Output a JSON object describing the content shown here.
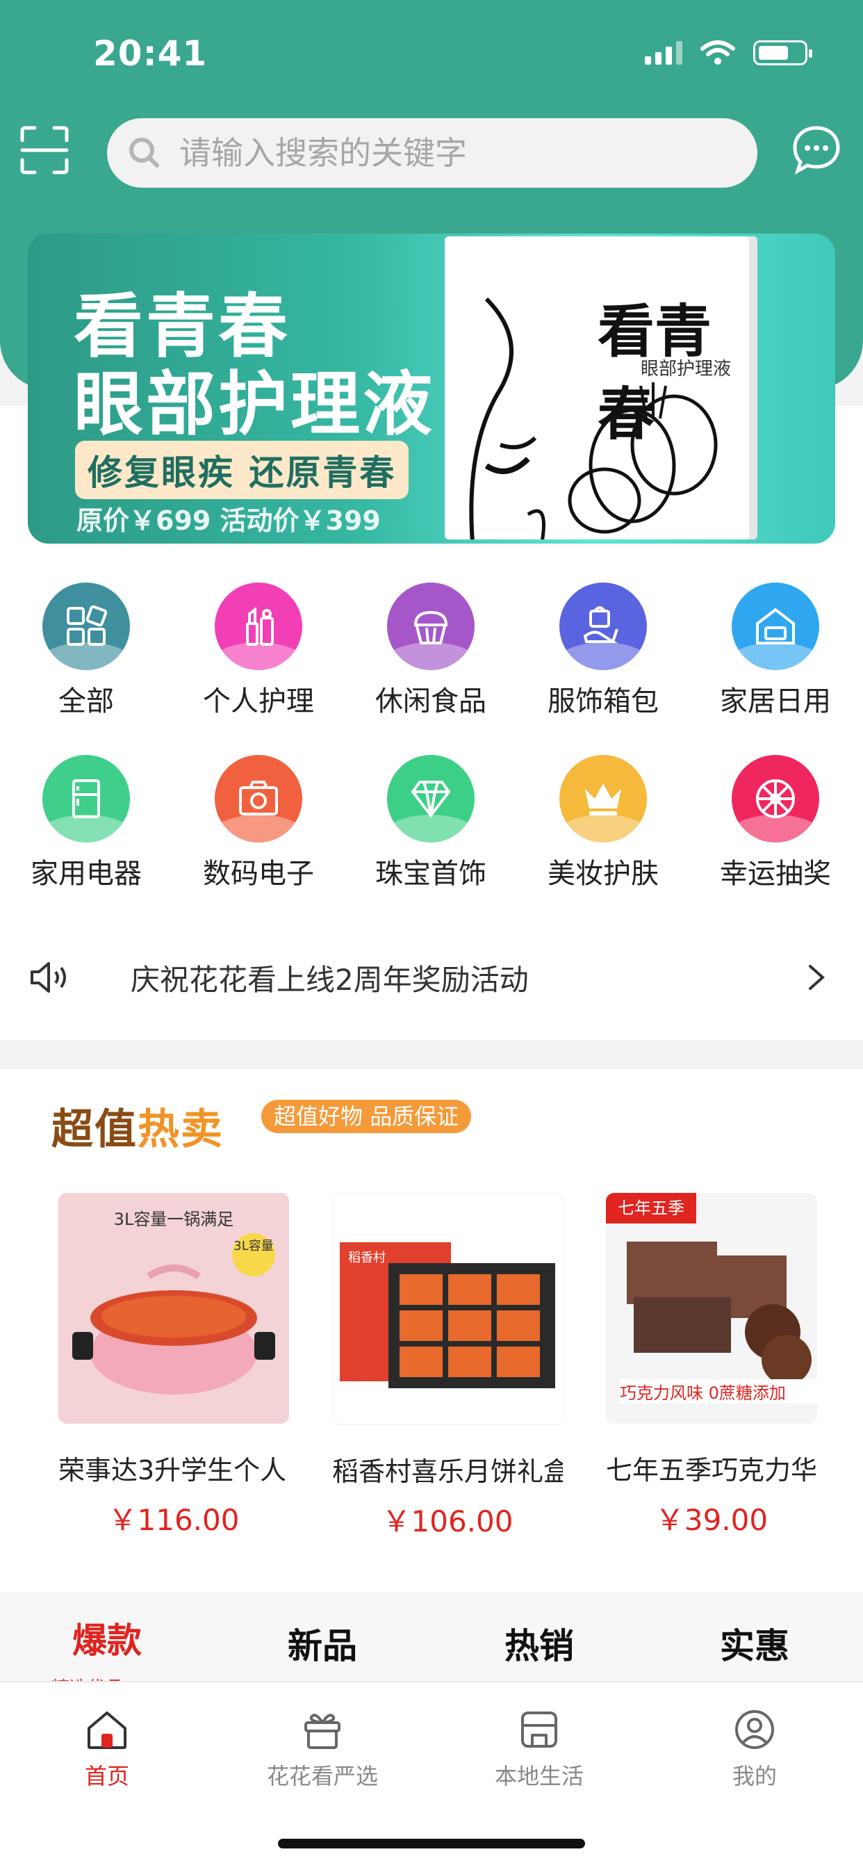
{
  "status": {
    "time": "20:41"
  },
  "search": {
    "placeholder": "请输入搜索的关键字"
  },
  "banner": {
    "line1": "看青春",
    "line2": "眼部护理液",
    "tagline": "修复眼疾 还原青春",
    "price_text": "原价￥699  活动价￥399",
    "box_name": "看青春",
    "box_sub": "眼部护理液"
  },
  "categories": [
    {
      "label": "全部",
      "color": "#3f8f9f",
      "icon": "grid-icon"
    },
    {
      "label": "个人护理",
      "color": "#f23fb5",
      "icon": "lipstick-icon"
    },
    {
      "label": "休闲食品",
      "color": "#a557c9",
      "icon": "cupcake-icon"
    },
    {
      "label": "服饰箱包",
      "color": "#5a64e0",
      "icon": "shoe-bag-icon"
    },
    {
      "label": "家居日用",
      "color": "#2fa7f0",
      "icon": "home-icon"
    },
    {
      "label": "家用电器",
      "color": "#3fcf8a",
      "icon": "fridge-icon"
    },
    {
      "label": "数码电子",
      "color": "#f2613f",
      "icon": "camera-icon"
    },
    {
      "label": "珠宝首饰",
      "color": "#3ccf86",
      "icon": "diamond-icon"
    },
    {
      "label": "美妆护肤",
      "color": "#f5b93c",
      "icon": "crown-icon"
    },
    {
      "label": "幸运抽奖",
      "color": "#f0265e",
      "icon": "wheel-icon"
    }
  ],
  "notice": {
    "text": "庆祝花花看上线2周年奖励活动"
  },
  "hot": {
    "title_a": "超值",
    "title_b": "热卖",
    "tag": "超值好物 品质保证",
    "products": [
      {
        "name": "荣事达3升学生个人",
        "price": "￥116.00",
        "img_caption": "3L容量一锅满足",
        "img_badge": "3L容量"
      },
      {
        "name": "稻香村喜乐月饼礼盒",
        "price": "￥106.00",
        "img_caption": "稻香村"
      },
      {
        "name": "七年五季巧克力华",
        "price": "￥39.00",
        "img_caption": "七年五季",
        "img_note": "巧克力风味 0蔗糖添加"
      }
    ]
  },
  "tabs": [
    {
      "label": "爆款",
      "active": true
    },
    {
      "label": "新品",
      "active": false
    },
    {
      "label": "热销",
      "active": false
    },
    {
      "label": "实惠",
      "active": false
    }
  ],
  "tab_sub": "精选优品",
  "nav": [
    {
      "label": "首页",
      "icon": "home-icon",
      "active": true
    },
    {
      "label": "花花看严选",
      "icon": "gift-icon",
      "active": false
    },
    {
      "label": "本地生活",
      "icon": "store-icon",
      "active": false
    },
    {
      "label": "我的",
      "icon": "user-icon",
      "active": false
    }
  ]
}
